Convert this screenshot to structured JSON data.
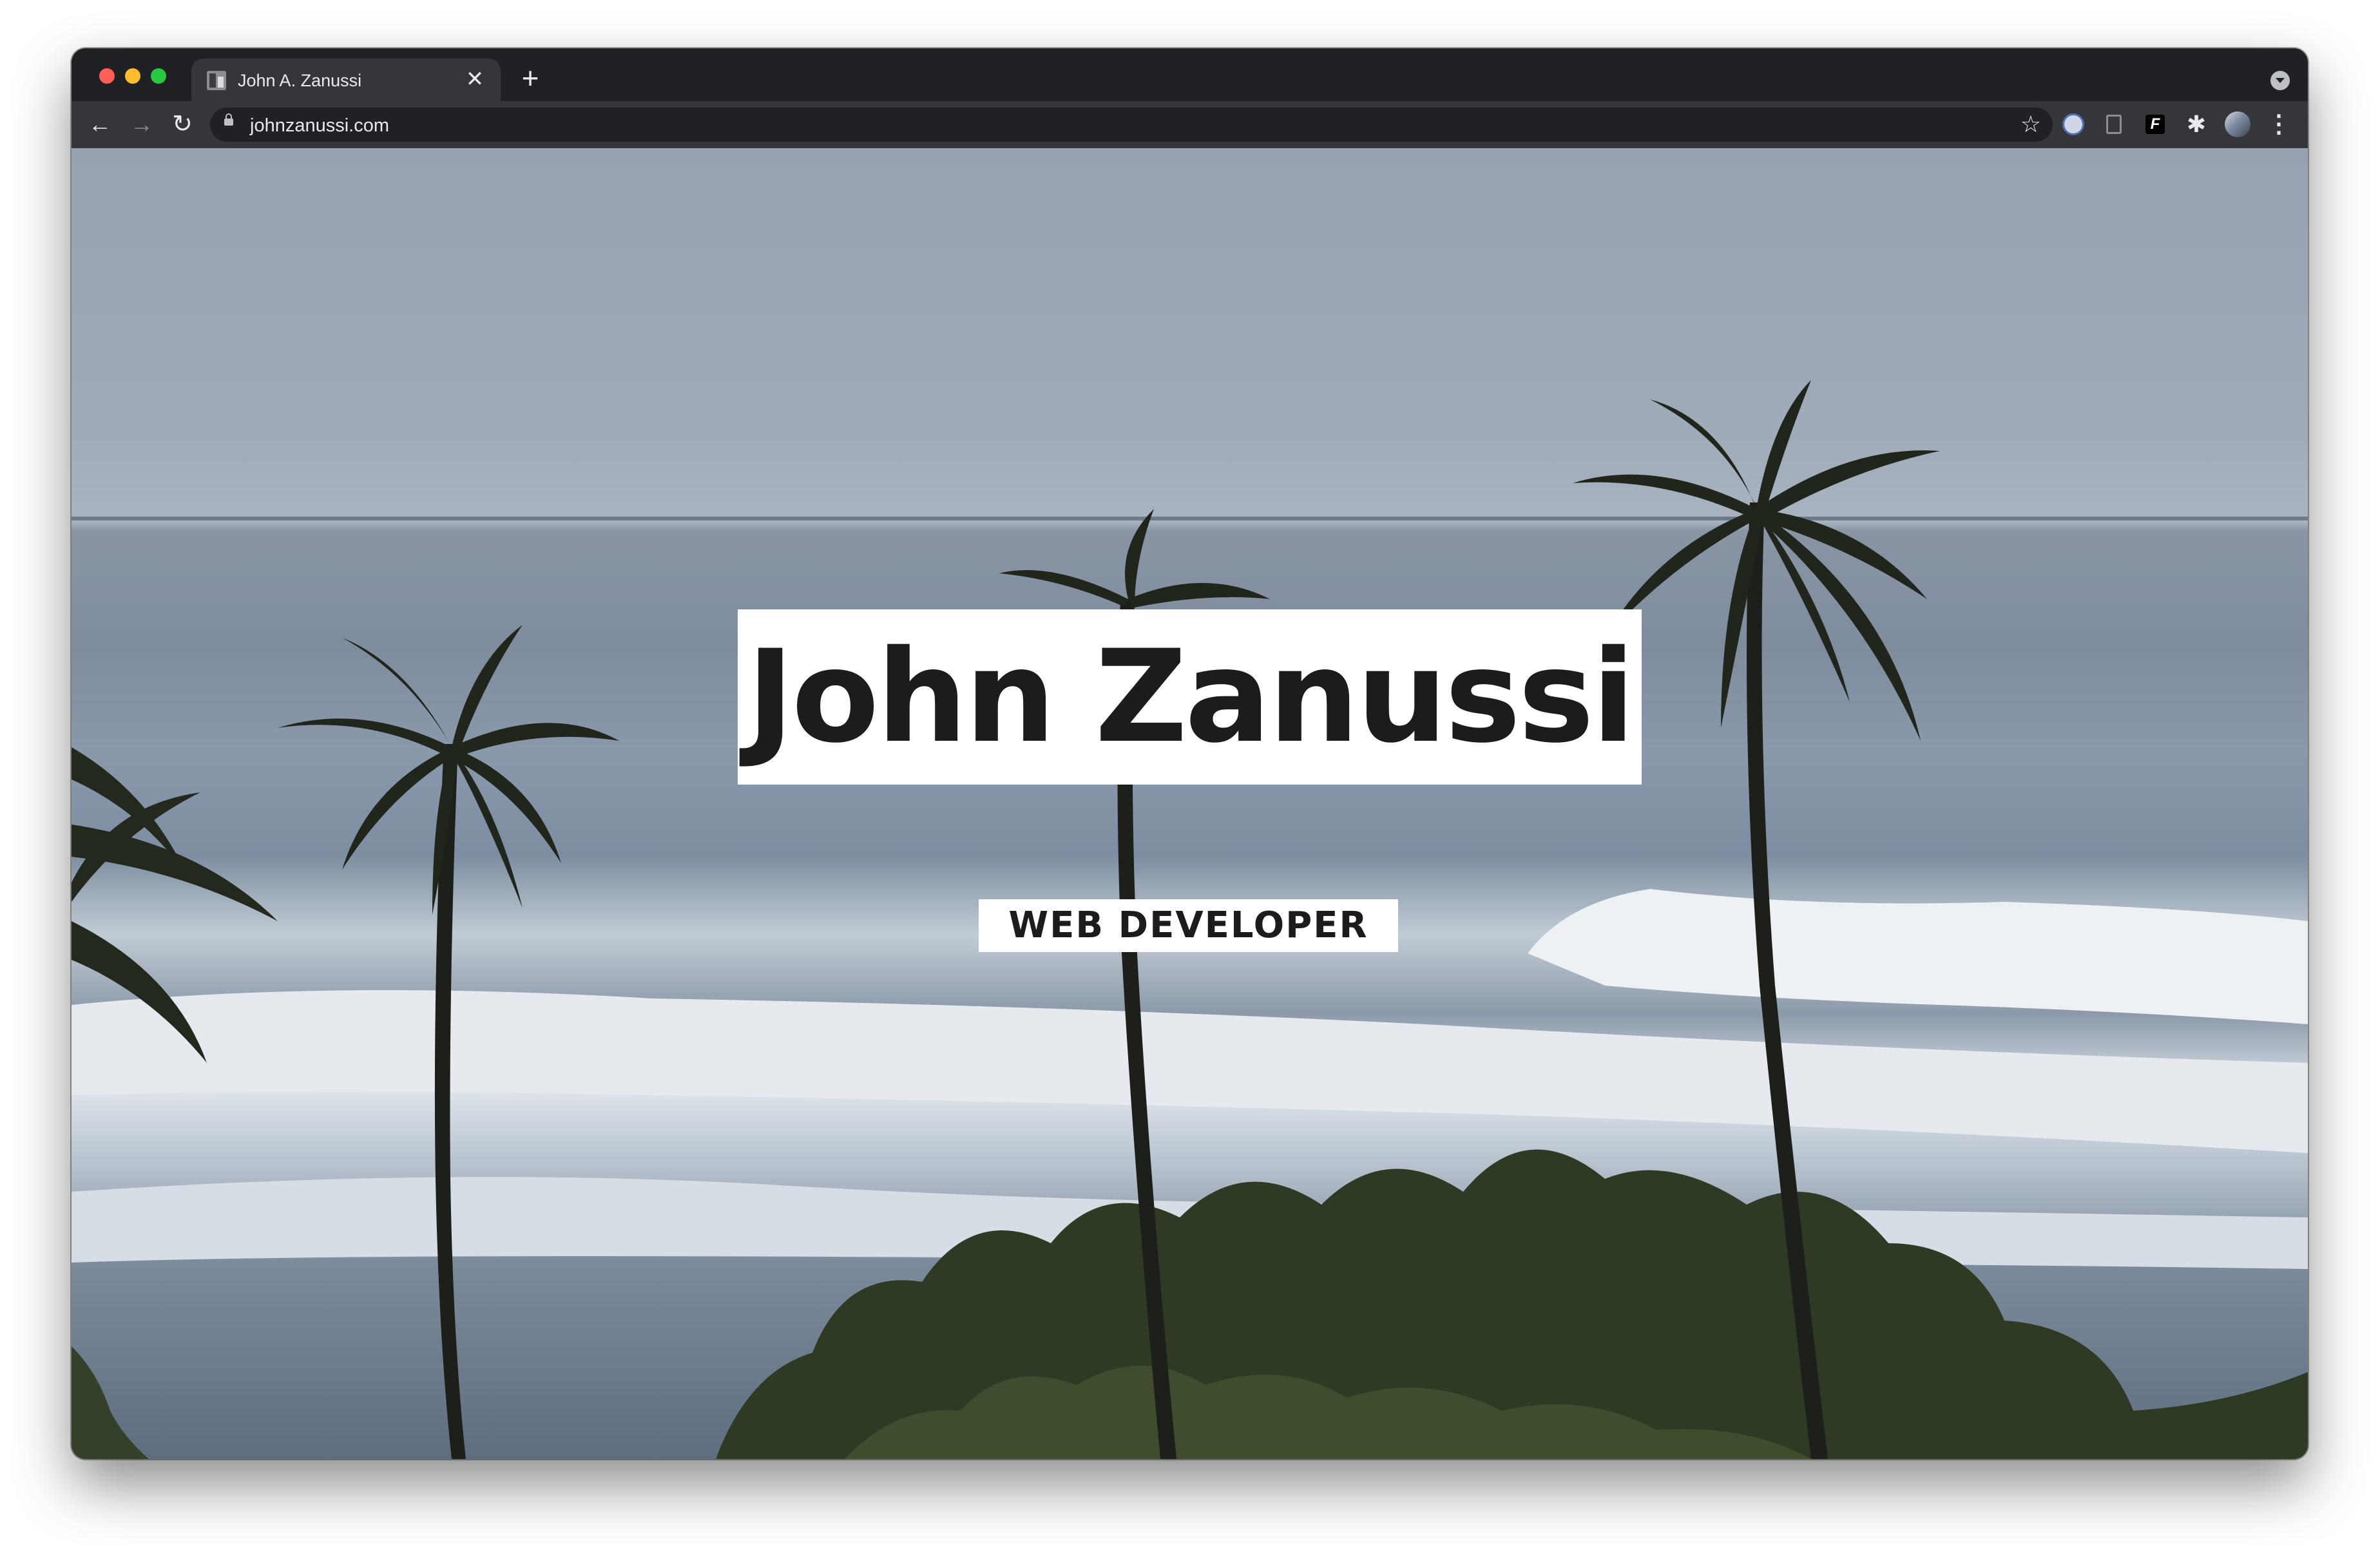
{
  "browser": {
    "tab": {
      "title": "John A. Zanussi",
      "close_glyph": "✕",
      "new_tab_glyph": "+"
    },
    "toolbar": {
      "back_glyph": "←",
      "forward_glyph": "→",
      "reload_glyph": "↻",
      "url": "johnzanussi.com",
      "bookmark_glyph": "☆",
      "extensions": [
        "password-manager-icon",
        "reader-icon",
        "f-extension-icon",
        "puzzle-extensions-icon",
        "profile-avatar",
        "kebab-menu-icon"
      ],
      "extension_puzzle_glyph": "✱",
      "f_extension_label": "F",
      "menu_glyph": "⋮"
    },
    "traffic_lights": [
      "#ff5f57",
      "#febc2e",
      "#28c840"
    ]
  },
  "hero": {
    "name": "John Zanussi",
    "role": "WEB DEVELOPER",
    "background_description": "ocean-waves-palm-trees-photo"
  },
  "colors": {
    "chrome_dark": "#202124",
    "chrome_toolbar": "#35363a",
    "text_light": "#e8eaed",
    "title_text": "#1c1c1c",
    "label_bg": "#ffffff"
  }
}
